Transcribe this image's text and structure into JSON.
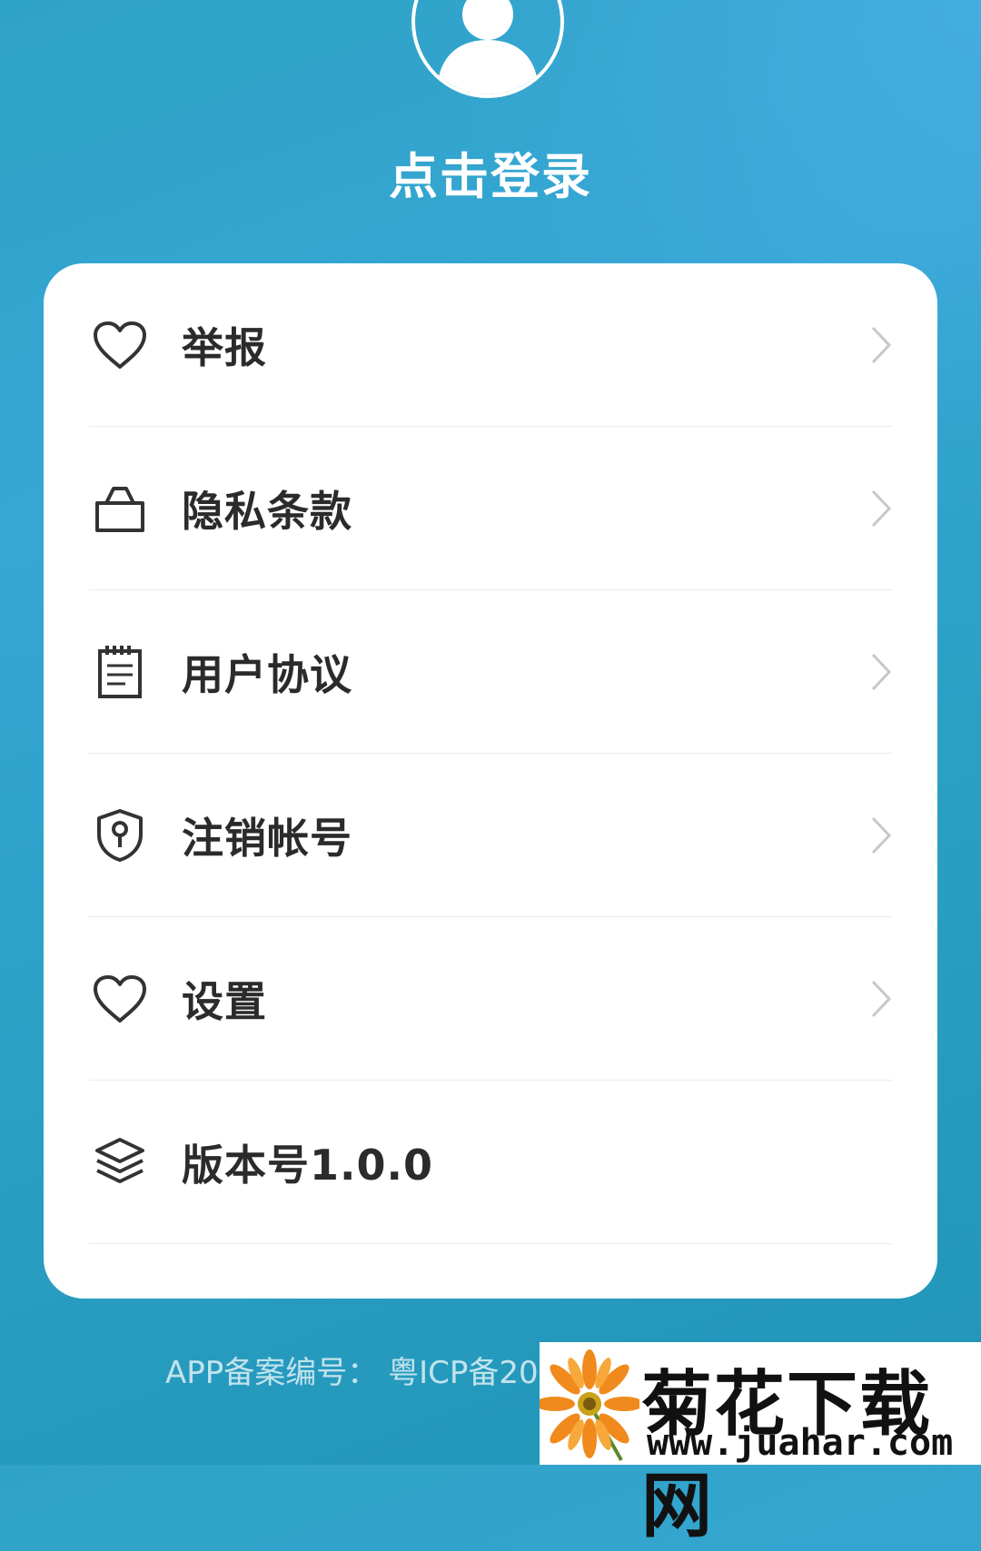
{
  "profile": {
    "login_label": "点击登录"
  },
  "menu": {
    "items": [
      {
        "label": "举报",
        "icon": "heart-icon",
        "has_arrow": true
      },
      {
        "label": "隐私条款",
        "icon": "bag-icon",
        "has_arrow": true
      },
      {
        "label": "用户协议",
        "icon": "notepad-icon",
        "has_arrow": true
      },
      {
        "label": "注销帐号",
        "icon": "shield-keyhole-icon",
        "has_arrow": true
      },
      {
        "label": "设置",
        "icon": "heart-icon",
        "has_arrow": true
      },
      {
        "label": "版本号1.0.0",
        "icon": "layers-icon",
        "has_arrow": false
      }
    ]
  },
  "footer": {
    "icp_text": "APP备案编号： 粤ICP备20"
  },
  "watermark": {
    "title": "菊花下载网",
    "url": "www.juahar.com"
  },
  "colors": {
    "background_start": "#2fa3c6",
    "background_end": "#2295b8",
    "card": "#ffffff",
    "label_text": "#2b2b2b",
    "chevron": "#c8c8c8"
  }
}
